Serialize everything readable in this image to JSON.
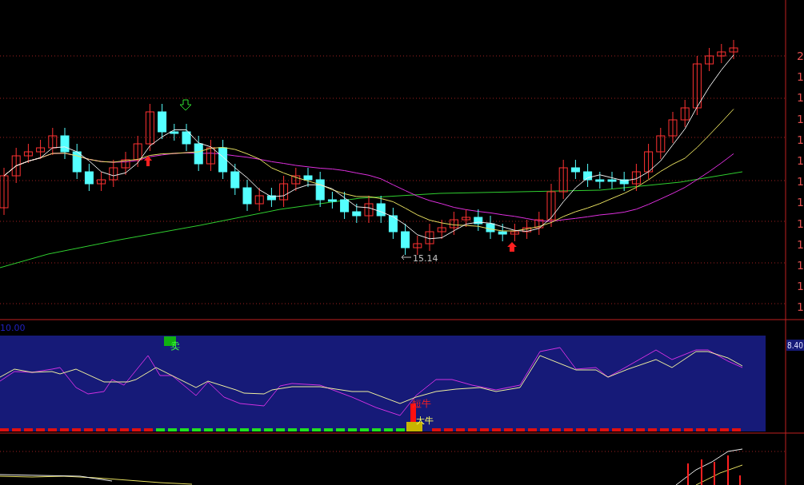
{
  "main_chart": {
    "axis_labels": [
      "2",
      "1",
      "1",
      "1",
      "1",
      "1",
      "1",
      "1",
      "1",
      "1",
      "1",
      "1",
      "1"
    ],
    "low_label": "15.14"
  },
  "indicator_panel": {
    "top_value": "10.00",
    "current_value": "8.40",
    "signals": [
      {
        "kind": "sell",
        "label": "卖"
      },
      {
        "kind": "short_bull",
        "label": "短牛"
      },
      {
        "kind": "big_bull",
        "label": "大牛"
      }
    ]
  }
}
